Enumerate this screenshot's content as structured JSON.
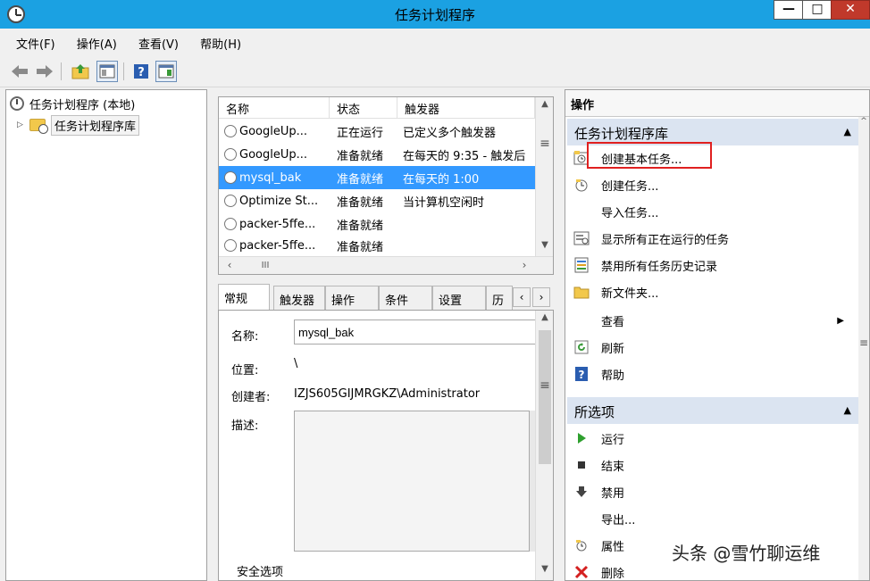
{
  "window": {
    "title": "任务计划程序",
    "minimize": "—",
    "maximize": "□",
    "close": "✕"
  },
  "menu": [
    "文件(F)",
    "操作(A)",
    "查看(V)",
    "帮助(H)"
  ],
  "toolbar": {
    "back_icon": "back-arrow-icon",
    "forward_icon": "forward-arrow-icon",
    "up_icon": "up-folder-icon",
    "show_hide_icon": "show-hide-console-tree-icon",
    "help_icon": "help-icon",
    "show_action_pane_icon": "show-action-pane-icon"
  },
  "tree": {
    "root": "任务计划程序 (本地)",
    "child": "任务计划程序库"
  },
  "tasklist": {
    "headers": [
      "名称",
      "状态",
      "触发器"
    ],
    "rows": [
      {
        "name": "GoogleUp...",
        "status": "正在运行",
        "trigger": "已定义多个触发器"
      },
      {
        "name": "GoogleUp...",
        "status": "准备就绪",
        "trigger": "在每天的 9:35 - 触发后"
      },
      {
        "name": "mysql_bak",
        "status": "准备就绪",
        "trigger": "在每天的 1:00"
      },
      {
        "name": "Optimize St...",
        "status": "准备就绪",
        "trigger": "当计算机空闲时"
      },
      {
        "name": "packer-5ffe...",
        "status": "准备就绪",
        "trigger": ""
      },
      {
        "name": "packer-5ffe...",
        "status": "准备就绪",
        "trigger": ""
      }
    ],
    "selected_index": 2,
    "hscroll_thumb": "III"
  },
  "tabs": [
    "常规",
    "触发器",
    "操作",
    "条件",
    "设置",
    "历"
  ],
  "detail": {
    "name_label": "名称:",
    "name_value": "mysql_bak",
    "location_label": "位置:",
    "location_value": "\\",
    "author_label": "创建者:",
    "author_value": "IZJS605GIJMRGKZ\\Administrator",
    "description_label": "描述:",
    "security_label": "安全选项"
  },
  "actions": {
    "header": "操作",
    "library_section": "任务计划程序库",
    "library_items": [
      {
        "label": "创建基本任务...",
        "icon": "create-basic-task-icon"
      },
      {
        "label": "创建任务...",
        "icon": "create-task-icon"
      },
      {
        "label": "导入任务...",
        "icon": ""
      },
      {
        "label": "显示所有正在运行的任务",
        "icon": "running-tasks-icon"
      },
      {
        "label": "禁用所有任务历史记录",
        "icon": "history-icon"
      },
      {
        "label": "新文件夹...",
        "icon": "new-folder-icon"
      },
      {
        "label": "查看",
        "icon": ""
      },
      {
        "label": "刷新",
        "icon": "refresh-icon"
      },
      {
        "label": "帮助",
        "icon": "help-icon"
      }
    ],
    "selected_section": "所选项",
    "selected_items": [
      {
        "label": "运行",
        "icon": "run-icon"
      },
      {
        "label": "结束",
        "icon": "end-icon"
      },
      {
        "label": "禁用",
        "icon": "disable-icon"
      },
      {
        "label": "导出...",
        "icon": ""
      },
      {
        "label": "属性",
        "icon": "properties-icon"
      },
      {
        "label": "删除",
        "icon": "delete-icon"
      }
    ]
  },
  "colors": {
    "titlebar": "#1ba1e2",
    "selection": "#3399ff",
    "section_header": "#dbe4f1",
    "highlight_box": "#e02020"
  },
  "watermark": "头条 @雪竹聊运维"
}
